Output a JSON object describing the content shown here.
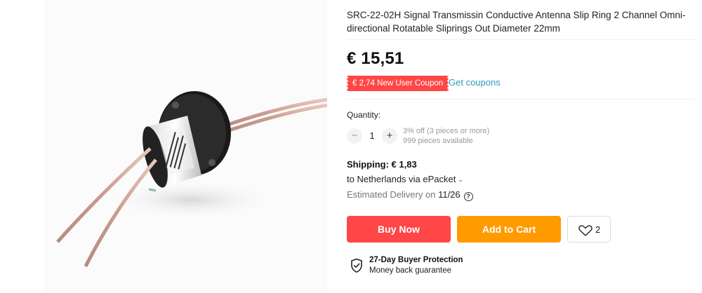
{
  "product": {
    "title": "SRC-22-02H Signal Transmissin Conductive Antenna Slip Ring 2 Channel Omni-directional Rotatable Sliprings Out Diameter 22mm",
    "price": "€ 15,51",
    "coupon_badge": "€ 2,74 New User Coupon",
    "get_coupons": "Get coupons"
  },
  "quantity": {
    "label": "Quantity:",
    "minus": "−",
    "plus": "+",
    "value": "1",
    "discount_note": "3% off (3 pieces or more)",
    "available": "999 pieces available"
  },
  "shipping": {
    "cost": "Shipping: € 1,83",
    "destination": "to Netherlands via ePacket",
    "delivery_prefix": "Estimated Delivery on",
    "delivery_date": "11/26",
    "help": "?"
  },
  "actions": {
    "buy_now": "Buy Now",
    "add_to_cart": "Add to Cart",
    "wishlist_count": "2"
  },
  "protection": {
    "title": "27-Day Buyer Protection",
    "subtitle": "Money back guarantee"
  },
  "colors": {
    "buy_now": "#ff4747",
    "add_to_cart": "#ff9a00",
    "coupon": "#ff4747",
    "link": "#2e9cc3"
  },
  "icons": {
    "wishlist": "heart-icon",
    "protection": "shield-check-icon",
    "help": "question-circle-icon",
    "dropdown": "chevron-down-icon"
  }
}
